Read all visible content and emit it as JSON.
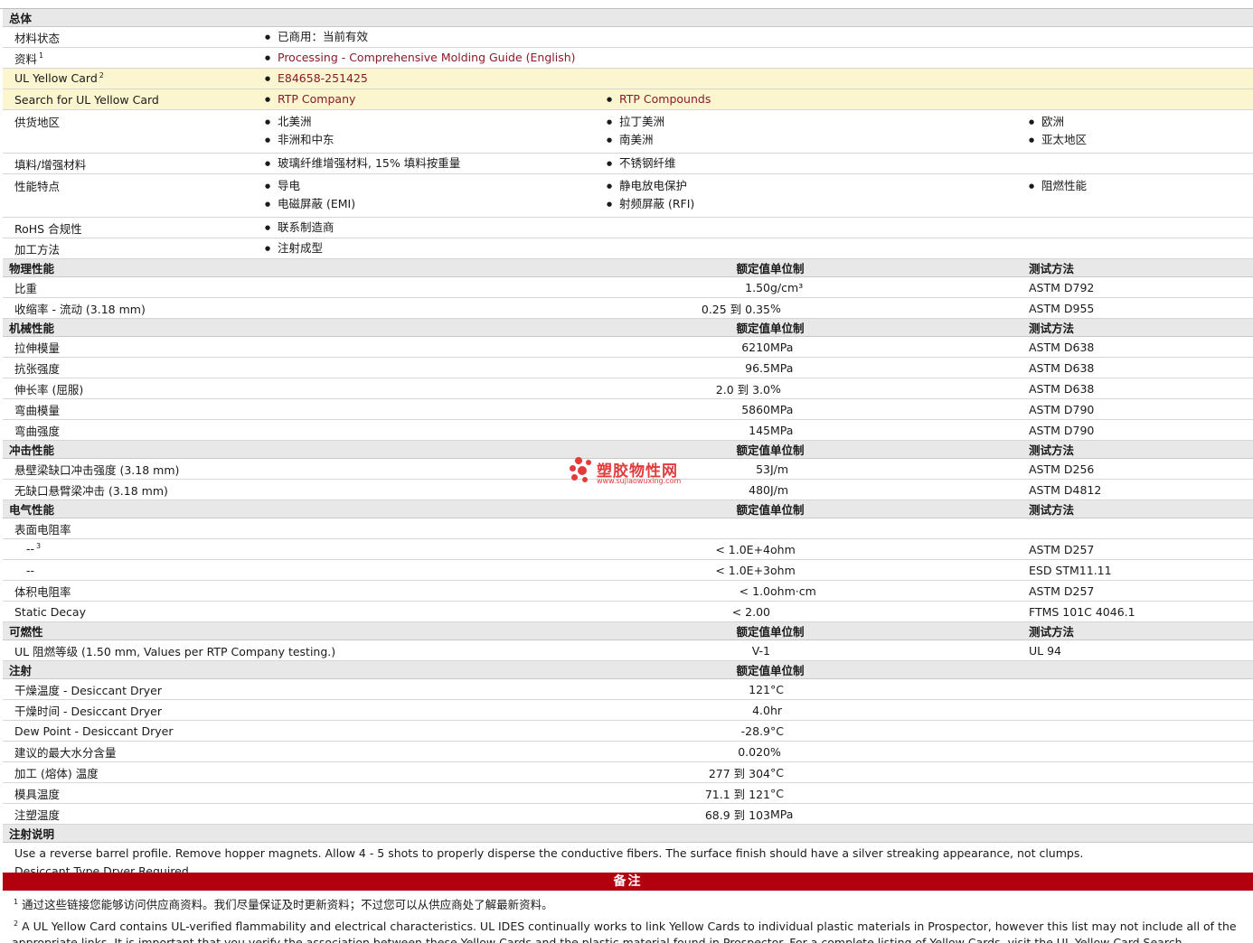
{
  "general": {
    "title": "总体",
    "rows": [
      {
        "label": "材料状态",
        "sup": "",
        "items": [
          "已商用：当前有效"
        ],
        "links": false,
        "yellow": false
      },
      {
        "label": "资料",
        "sup": "1",
        "items": [
          "Processing - Comprehensive Molding Guide (English)"
        ],
        "links": true,
        "yellow": false
      },
      {
        "label": "UL Yellow Card",
        "sup": "2",
        "items": [
          "E84658-251425"
        ],
        "links": true,
        "yellow": true
      },
      {
        "label": "Search for UL Yellow Card",
        "sup": "",
        "items": [
          "RTP Company",
          "RTP Compounds"
        ],
        "links": true,
        "yellow": true
      }
    ],
    "supply_region": {
      "label": "供货地区",
      "col1": [
        "北美洲",
        "非洲和中东"
      ],
      "col2": [
        "拉丁美洲",
        "南美洲"
      ],
      "col3": [
        "欧洲",
        "亚太地区"
      ]
    },
    "filler": {
      "label": "填料/增强材料",
      "col1": [
        "玻璃纤维增强材料, 15% 填料按重量"
      ],
      "col2": [
        "不锈钢纤维"
      ],
      "col3": []
    },
    "features": {
      "label": "性能特点",
      "col1": [
        "导电",
        "电磁屏蔽 (EMI)"
      ],
      "col2": [
        "静电放电保护",
        "射频屏蔽 (RFI)"
      ],
      "col3": [
        "阻燃性能"
      ]
    },
    "rohs": {
      "label": "RoHS 合规性",
      "items": [
        "联系制造商"
      ]
    },
    "process": {
      "label": "加工方法",
      "items": [
        "注射成型"
      ]
    }
  },
  "headers": {
    "nominal": "额定值",
    "unit": "单位制",
    "method": "测试方法"
  },
  "sections": [
    {
      "title": "物理性能",
      "rows": [
        {
          "label": "比重",
          "value": "1.50",
          "unit": "g/cm³",
          "method": "ASTM D792"
        },
        {
          "label": "收缩率 - 流动 (3.18 mm)",
          "value": "0.25 到  0.35",
          "unit": "%",
          "method": "ASTM D955"
        }
      ]
    },
    {
      "title": "机械性能",
      "rows": [
        {
          "label": "拉伸模量",
          "value": "6210",
          "unit": "MPa",
          "method": "ASTM D638"
        },
        {
          "label": "抗张强度",
          "value": "96.5",
          "unit": "MPa",
          "method": "ASTM D638"
        },
        {
          "label": "伸长率 (屈服)",
          "value": "2.0 到  3.0",
          "unit": "%",
          "method": "ASTM D638"
        },
        {
          "label": "弯曲模量",
          "value": "5860",
          "unit": "MPa",
          "method": "ASTM D790"
        },
        {
          "label": "弯曲强度",
          "value": "145",
          "unit": "MPa",
          "method": "ASTM D790"
        }
      ]
    },
    {
      "title": "冲击性能",
      "rows": [
        {
          "label": "悬壁梁缺口冲击强度 (3.18 mm)",
          "value": "53",
          "unit": "J/m",
          "method": "ASTM D256"
        },
        {
          "label": "无缺口悬臂梁冲击 (3.18 mm)",
          "value": "480",
          "unit": "J/m",
          "method": "ASTM D4812"
        }
      ]
    },
    {
      "title": "电气性能",
      "rows": [
        {
          "label": "表面电阻率",
          "value": "",
          "unit": "",
          "method": ""
        },
        {
          "label": "--",
          "sup": "3",
          "sub": true,
          "value": "< 1.0E+4",
          "unit": "ohm",
          "method": "ASTM D257"
        },
        {
          "label": "--",
          "sub": true,
          "value": "< 1.0E+3",
          "unit": "ohm",
          "method": "ESD STM11.11"
        },
        {
          "label": "体积电阻率",
          "value": "< 1.0",
          "unit": "ohm·cm",
          "method": "ASTM D257"
        },
        {
          "label": "Static Decay",
          "value": "< 2.00",
          "unit": "",
          "method": "FTMS 101C 4046.1"
        }
      ]
    },
    {
      "title": "可燃性",
      "rows": [
        {
          "label": "UL 阻燃等级 (1.50 mm, Values per RTP Company testing.)",
          "value": "V-1",
          "unit": "",
          "method": "UL 94",
          "left_value": true
        }
      ]
    },
    {
      "title": "注射",
      "nomethod": true,
      "rows": [
        {
          "label": "干燥温度 - Desiccant Dryer",
          "value": "121",
          "unit": "°C",
          "method": ""
        },
        {
          "label": "干燥时间 - Desiccant Dryer",
          "value": "4.0",
          "unit": "hr",
          "method": ""
        },
        {
          "label": "Dew Point - Desiccant Dryer",
          "value": "-28.9",
          "unit": "°C",
          "method": ""
        },
        {
          "label": "建议的最大水分含量",
          "value": "0.020",
          "unit": "%",
          "method": ""
        },
        {
          "label": "加工 (熔体) 温度",
          "value": "277 到  304",
          "unit": "°C",
          "method": ""
        },
        {
          "label": "模具温度",
          "value": "71.1 到  121",
          "unit": "°C",
          "method": ""
        },
        {
          "label": "注塑温度",
          "value": "68.9 到  103",
          "unit": "MPa",
          "method": ""
        }
      ]
    }
  ],
  "injection_notes": {
    "title": "注射说明",
    "lines": [
      "Use a reverse barrel profile. Remove hopper magnets. Allow 4 - 5 shots to properly disperse the conductive fibers. The surface finish should have a silver streaking appearance, not clumps.",
      "Desiccant Type Dryer Required."
    ]
  },
  "remarks": {
    "title": "备注",
    "fn1_num": "1",
    "fn1": "通过这些链接您能够访问供应商资料。我们尽量保证及时更新资料；不过您可以从供应商处了解最新资料。",
    "fn2_num": "2",
    "fn2": "A UL Yellow Card contains UL-verified flammability and electrical characteristics. UL IDES continually works to link Yellow Cards to individual plastic materials in Prospector, however this list may not include all of the appropriate links. It is important that you verify the association between these Yellow Cards and the plastic material found in Prospector. For a complete listing of Yellow Cards, visit the UL Yellow Card Search."
  },
  "watermark": {
    "title": "塑胶物性网",
    "url": "www.sujiaowuxing.com",
    "color": "#e23b3b"
  },
  "colors": {
    "link": "#8b1a2a",
    "header_bg": "#e8e8e8",
    "yellow_row": "#fbf5d0",
    "red_bar": "#b3000f"
  }
}
